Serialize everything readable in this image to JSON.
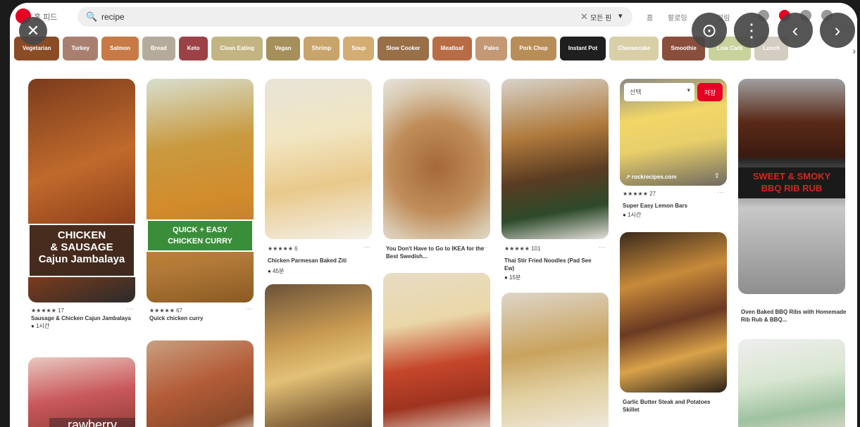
{
  "header": {
    "home_label": "홈 피드",
    "search_value": "recipe",
    "search_scope": "모든 핀",
    "nav_items": [
      "홈",
      "팔로잉",
      "알림"
    ]
  },
  "overlay": {
    "close": "✕",
    "lens": "⊙",
    "more": "⋮",
    "prev": "‹",
    "next": "›"
  },
  "chips": [
    {
      "label": "Vegetarian",
      "color": "#8a4b25"
    },
    {
      "label": "Turkey",
      "color": "#a98070"
    },
    {
      "label": "Salmon",
      "color": "#c77a45"
    },
    {
      "label": "Bread",
      "color": "#b6aa9c"
    },
    {
      "label": "Keto",
      "color": "#9c4247"
    },
    {
      "label": "Clean Eating",
      "color": "#c2b582"
    },
    {
      "label": "Vegan",
      "color": "#a58f5a"
    },
    {
      "label": "Shrimp",
      "color": "#c9a46a"
    },
    {
      "label": "Soup",
      "color": "#d4ad72"
    },
    {
      "label": "Slow Cooker",
      "color": "#996f48"
    },
    {
      "label": "Meatloaf",
      "color": "#b86c45"
    },
    {
      "label": "Paleo",
      "color": "#c49874"
    },
    {
      "label": "Pork Chop",
      "color": "#b98d57"
    },
    {
      "label": "Instant Pot",
      "color": "#1f1f1f"
    },
    {
      "label": "Cheesecake",
      "color": "#d9cfa7"
    },
    {
      "label": "Smoothie",
      "color": "#8a4e3c"
    },
    {
      "label": "Low Carb",
      "color": "#c8d29b"
    },
    {
      "label": "Lunch",
      "color": "#d3ccc0"
    }
  ],
  "pins": [
    {
      "banner": "CHICKEN\n& SAUSAGE\nCajun Jambalaya",
      "stars": "★★★★★ 17",
      "title": "Sausage & Chicken Cajun Jambalaya",
      "time": "● 1시간"
    },
    {
      "banner": "QUICK + EASY\nCHICKEN CURRY",
      "stars": "★★★★★ 67",
      "title": "Quick chicken curry",
      "time": ""
    },
    {
      "banner": "",
      "stars": "★★★★★ 6",
      "title": "Chicken Parmesan Baked Ziti",
      "time": "● 45분"
    },
    {
      "banner": "",
      "stars": "",
      "title": "You Don't Have to Go to IKEA for the Best Swedish...",
      "time": ""
    },
    {
      "banner": "",
      "stars": "★★★★★ 101",
      "title": "Thai Stir Fried Noodles (Pad See Ew)",
      "time": "● 15분"
    },
    {
      "banner": "",
      "stars": "★★★★★ 27",
      "title": "Super Easy Lemon Bars",
      "time": "● 1시간",
      "select": "선택",
      "save": "저장",
      "source": "↗ rockrecipes.com"
    },
    {
      "banner": "SWEET & SMOKY\nBBQ RIB RUB",
      "stars": "",
      "title": "Oven Baked BBQ Ribs with Homemade Rib Rub & BBQ...",
      "time": ""
    },
    {
      "banner": "",
      "stars": "",
      "title": "Garlic Butter Steak and Potatoes Skillet",
      "time": ""
    }
  ],
  "bottom_pin": {
    "banner": "rawberry"
  },
  "colors": {
    "accent": "#e60023",
    "curry_green": "#3a8e3a",
    "rib_red": "#cc2a1f"
  }
}
